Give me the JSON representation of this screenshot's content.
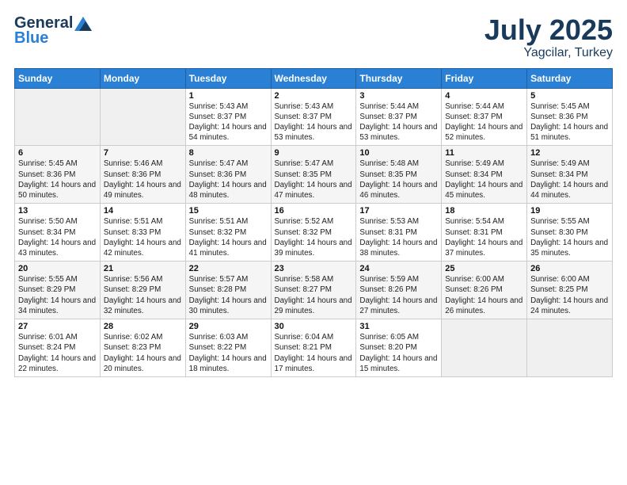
{
  "header": {
    "logo_general": "General",
    "logo_blue": "Blue",
    "title": "July 2025",
    "location": "Yagcilar, Turkey"
  },
  "days_of_week": [
    "Sunday",
    "Monday",
    "Tuesday",
    "Wednesday",
    "Thursday",
    "Friday",
    "Saturday"
  ],
  "weeks": [
    [
      {
        "day": "",
        "info": ""
      },
      {
        "day": "",
        "info": ""
      },
      {
        "day": "1",
        "info": "Sunrise: 5:43 AM\nSunset: 8:37 PM\nDaylight: 14 hours and 54 minutes."
      },
      {
        "day": "2",
        "info": "Sunrise: 5:43 AM\nSunset: 8:37 PM\nDaylight: 14 hours and 53 minutes."
      },
      {
        "day": "3",
        "info": "Sunrise: 5:44 AM\nSunset: 8:37 PM\nDaylight: 14 hours and 53 minutes."
      },
      {
        "day": "4",
        "info": "Sunrise: 5:44 AM\nSunset: 8:37 PM\nDaylight: 14 hours and 52 minutes."
      },
      {
        "day": "5",
        "info": "Sunrise: 5:45 AM\nSunset: 8:36 PM\nDaylight: 14 hours and 51 minutes."
      }
    ],
    [
      {
        "day": "6",
        "info": "Sunrise: 5:45 AM\nSunset: 8:36 PM\nDaylight: 14 hours and 50 minutes."
      },
      {
        "day": "7",
        "info": "Sunrise: 5:46 AM\nSunset: 8:36 PM\nDaylight: 14 hours and 49 minutes."
      },
      {
        "day": "8",
        "info": "Sunrise: 5:47 AM\nSunset: 8:36 PM\nDaylight: 14 hours and 48 minutes."
      },
      {
        "day": "9",
        "info": "Sunrise: 5:47 AM\nSunset: 8:35 PM\nDaylight: 14 hours and 47 minutes."
      },
      {
        "day": "10",
        "info": "Sunrise: 5:48 AM\nSunset: 8:35 PM\nDaylight: 14 hours and 46 minutes."
      },
      {
        "day": "11",
        "info": "Sunrise: 5:49 AM\nSunset: 8:34 PM\nDaylight: 14 hours and 45 minutes."
      },
      {
        "day": "12",
        "info": "Sunrise: 5:49 AM\nSunset: 8:34 PM\nDaylight: 14 hours and 44 minutes."
      }
    ],
    [
      {
        "day": "13",
        "info": "Sunrise: 5:50 AM\nSunset: 8:34 PM\nDaylight: 14 hours and 43 minutes."
      },
      {
        "day": "14",
        "info": "Sunrise: 5:51 AM\nSunset: 8:33 PM\nDaylight: 14 hours and 42 minutes."
      },
      {
        "day": "15",
        "info": "Sunrise: 5:51 AM\nSunset: 8:32 PM\nDaylight: 14 hours and 41 minutes."
      },
      {
        "day": "16",
        "info": "Sunrise: 5:52 AM\nSunset: 8:32 PM\nDaylight: 14 hours and 39 minutes."
      },
      {
        "day": "17",
        "info": "Sunrise: 5:53 AM\nSunset: 8:31 PM\nDaylight: 14 hours and 38 minutes."
      },
      {
        "day": "18",
        "info": "Sunrise: 5:54 AM\nSunset: 8:31 PM\nDaylight: 14 hours and 37 minutes."
      },
      {
        "day": "19",
        "info": "Sunrise: 5:55 AM\nSunset: 8:30 PM\nDaylight: 14 hours and 35 minutes."
      }
    ],
    [
      {
        "day": "20",
        "info": "Sunrise: 5:55 AM\nSunset: 8:29 PM\nDaylight: 14 hours and 34 minutes."
      },
      {
        "day": "21",
        "info": "Sunrise: 5:56 AM\nSunset: 8:29 PM\nDaylight: 14 hours and 32 minutes."
      },
      {
        "day": "22",
        "info": "Sunrise: 5:57 AM\nSunset: 8:28 PM\nDaylight: 14 hours and 30 minutes."
      },
      {
        "day": "23",
        "info": "Sunrise: 5:58 AM\nSunset: 8:27 PM\nDaylight: 14 hours and 29 minutes."
      },
      {
        "day": "24",
        "info": "Sunrise: 5:59 AM\nSunset: 8:26 PM\nDaylight: 14 hours and 27 minutes."
      },
      {
        "day": "25",
        "info": "Sunrise: 6:00 AM\nSunset: 8:26 PM\nDaylight: 14 hours and 26 minutes."
      },
      {
        "day": "26",
        "info": "Sunrise: 6:00 AM\nSunset: 8:25 PM\nDaylight: 14 hours and 24 minutes."
      }
    ],
    [
      {
        "day": "27",
        "info": "Sunrise: 6:01 AM\nSunset: 8:24 PM\nDaylight: 14 hours and 22 minutes."
      },
      {
        "day": "28",
        "info": "Sunrise: 6:02 AM\nSunset: 8:23 PM\nDaylight: 14 hours and 20 minutes."
      },
      {
        "day": "29",
        "info": "Sunrise: 6:03 AM\nSunset: 8:22 PM\nDaylight: 14 hours and 18 minutes."
      },
      {
        "day": "30",
        "info": "Sunrise: 6:04 AM\nSunset: 8:21 PM\nDaylight: 14 hours and 17 minutes."
      },
      {
        "day": "31",
        "info": "Sunrise: 6:05 AM\nSunset: 8:20 PM\nDaylight: 14 hours and 15 minutes."
      },
      {
        "day": "",
        "info": ""
      },
      {
        "day": "",
        "info": ""
      }
    ]
  ]
}
